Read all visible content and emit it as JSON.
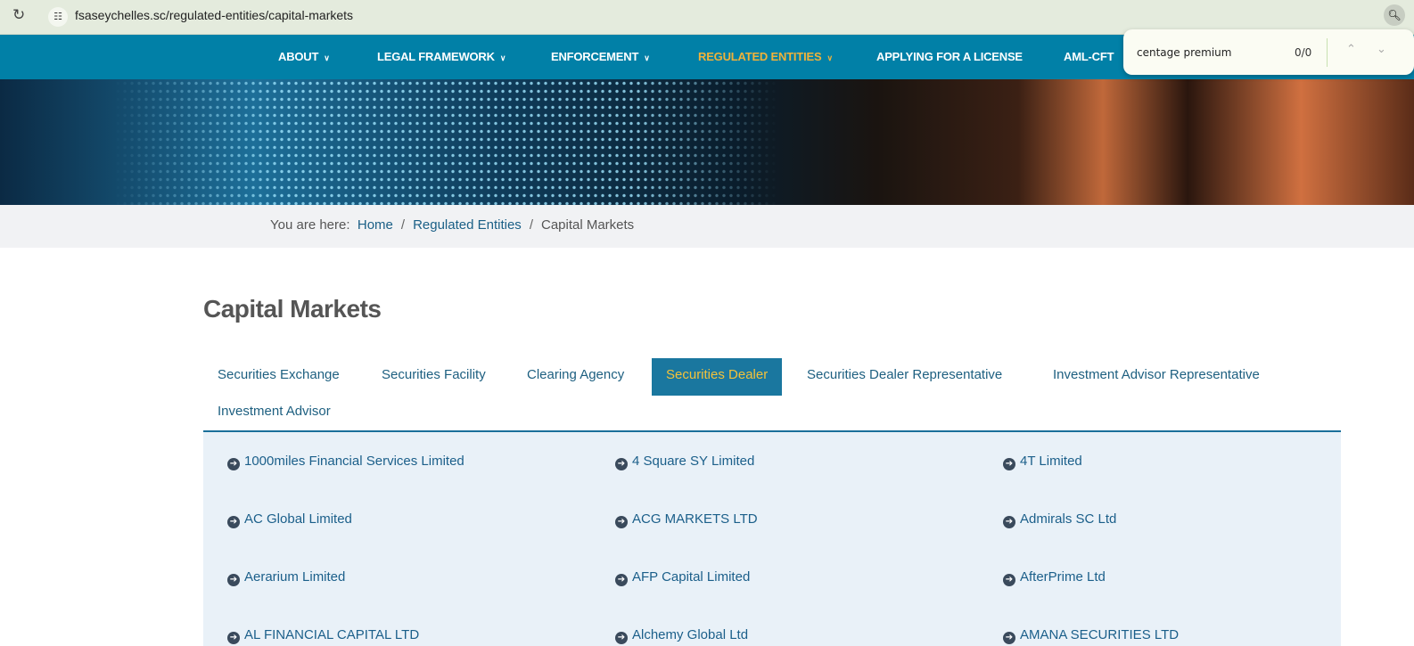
{
  "browser": {
    "url": "fsaseychelles.sc/regulated-entities/capital-markets"
  },
  "find_bar": {
    "query": "centage premium",
    "count": "0/0"
  },
  "nav": {
    "items": [
      {
        "label": "ABOUT",
        "chev": true
      },
      {
        "label": "LEGAL FRAMEWORK",
        "chev": true
      },
      {
        "label": "ENFORCEMENT",
        "chev": true
      },
      {
        "label": "REGULATED ENTITIES",
        "chev": true,
        "active": true
      },
      {
        "label": "APPLYING FOR A LICENSE"
      },
      {
        "label": "AML-CFT"
      }
    ]
  },
  "breadcrumb": {
    "prefix": "You are here:",
    "home": "Home",
    "parent": "Regulated Entities",
    "current": "Capital Markets",
    "sep": "/"
  },
  "page_title": "Capital Markets",
  "tabs": [
    "Securities Exchange",
    "Securities Facility",
    "Clearing Agency",
    "Securities Dealer",
    "Securities Dealer Representative",
    "Investment Advisor Representative",
    "Investment Advisor"
  ],
  "active_tab": "Securities Dealer",
  "entities": [
    "1000miles Financial Services Limited",
    "4 Square SY Limited",
    "4T Limited",
    "AC Global Limited",
    "ACG MARKETS LTD",
    "Admirals SC Ltd",
    "Aerarium Limited",
    "AFP Capital Limited",
    "AfterPrime Ltd",
    "AL FINANCIAL CAPITAL LTD",
    "Alchemy Global Ltd",
    "AMANA SECURITIES LTD"
  ]
}
